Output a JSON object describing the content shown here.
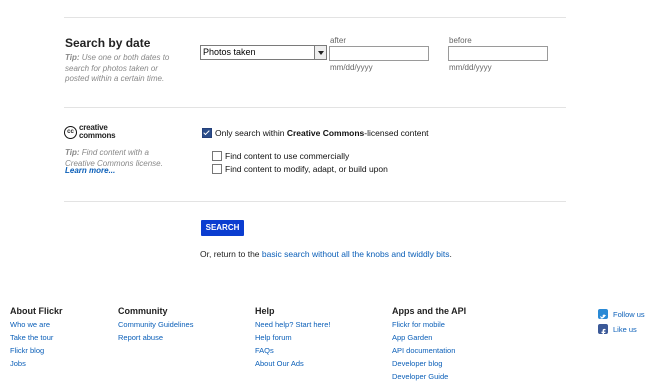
{
  "search_by_date": {
    "title": "Search by date",
    "tip_prefix": "Tip:",
    "tip_text": "Use one or both dates to search for photos taken or posted within a certain time.",
    "select_value": "Photos taken",
    "after_label": "after",
    "before_label": "before",
    "after_placeholder": "mm/dd/yyyy",
    "before_placeholder": "mm/dd/yyyy"
  },
  "creative_commons": {
    "logo_line1": "creative",
    "logo_line2": "commons",
    "tip_prefix": "Tip:",
    "tip_text": "Find content with a Creative Commons license.",
    "learn_more": "Learn more...",
    "only_cc_pre": "Only search within ",
    "only_cc_bold": "Creative Commons",
    "only_cc_post": "-licensed content",
    "opt_commercial": "Find content to use commercially",
    "opt_modify": "Find content to modify, adapt, or build upon"
  },
  "search_button": "SEARCH",
  "return_line": {
    "prefix": "Or, return to the ",
    "link": "basic search without all the knobs and twiddly bits",
    "suffix": "."
  },
  "footer": {
    "about": {
      "title": "About Flickr",
      "links": [
        "Who we are",
        "Take the tour",
        "Flickr blog",
        "Jobs"
      ]
    },
    "community": {
      "title": "Community",
      "links": [
        "Community Guidelines",
        "Report abuse"
      ]
    },
    "help": {
      "title": "Help",
      "links": [
        "Need help? Start here!",
        "Help forum",
        "FAQs",
        "About Our Ads"
      ]
    },
    "apps": {
      "title": "Apps and the API",
      "links": [
        "Flickr for mobile",
        "App Garden",
        "API documentation",
        "Developer blog",
        "Developer Guide"
      ]
    },
    "social": {
      "twitter": "Follow us",
      "facebook": "Like us"
    }
  },
  "colors": {
    "link": "#0b5fb8",
    "button": "#0b3dd0",
    "twitter": "#2a8ad6",
    "facebook": "#3b5998"
  }
}
